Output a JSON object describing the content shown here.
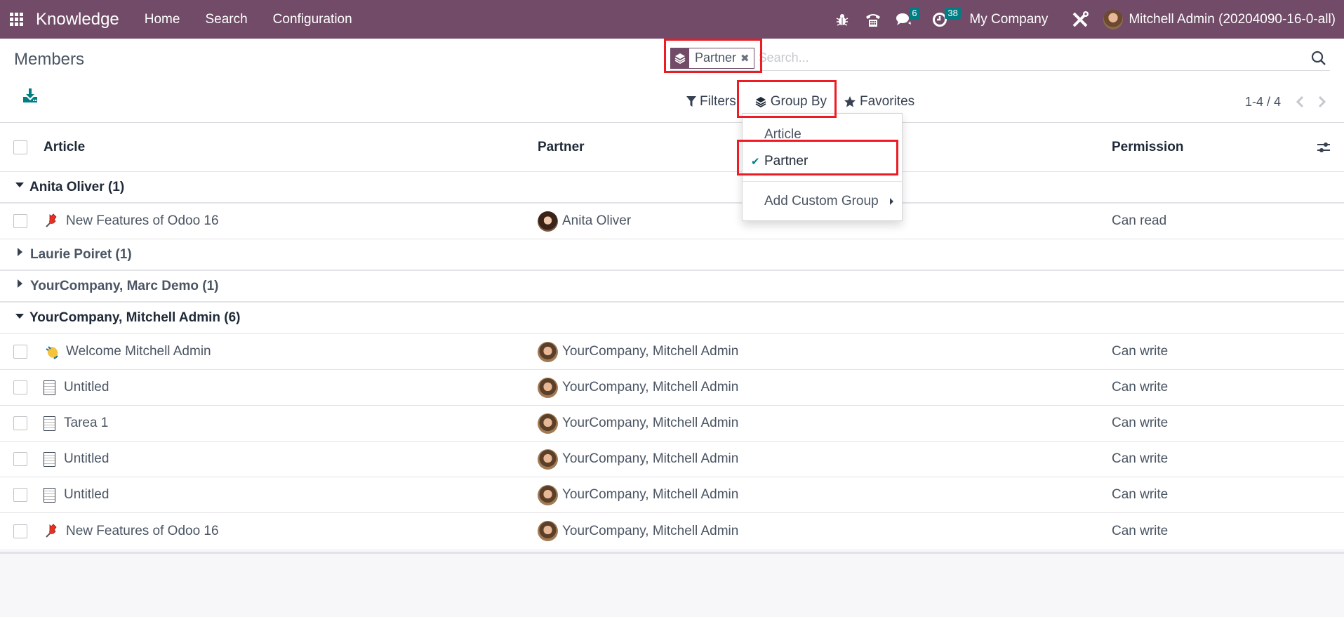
{
  "navbar": {
    "app_name": "Knowledge",
    "menus": [
      "Home",
      "Search",
      "Configuration"
    ],
    "messages_badge": "6",
    "activities_badge": "38",
    "company": "My Company",
    "user": "Mitchell Admin (20204090-16-0-all)",
    "accent_color": "#714b67",
    "badge_color": "#017e84"
  },
  "control": {
    "title": "Members",
    "search": {
      "facet_label": "Partner",
      "placeholder": "Search..."
    },
    "filters_label": "Filters",
    "group_by_label": "Group By",
    "favorites_label": "Favorites",
    "pager": "1-4 / 4"
  },
  "group_by_dropdown": {
    "items": [
      {
        "label": "Article",
        "checked": false
      },
      {
        "label": "Partner",
        "checked": true
      }
    ],
    "custom_group_label": "Add Custom Group"
  },
  "table": {
    "columns": [
      "Article",
      "Partner",
      "Permission"
    ],
    "groups": [
      {
        "label": "Anita Oliver (1)",
        "expanded": true,
        "rows": [
          {
            "icon": "pushpin",
            "article": "New Features of Odoo 16",
            "partner": "Anita Oliver",
            "permission": "Can read"
          }
        ]
      },
      {
        "label": "Laurie Poiret (1)",
        "expanded": false,
        "rows": []
      },
      {
        "label": "YourCompany, Marc Demo (1)",
        "expanded": false,
        "rows": []
      },
      {
        "label": "YourCompany, Mitchell Admin (6)",
        "expanded": true,
        "rows": [
          {
            "icon": "waving-hand",
            "article": "Welcome Mitchell Admin",
            "partner": "YourCompany, Mitchell Admin",
            "permission": "Can write"
          },
          {
            "icon": "document",
            "article": "Untitled",
            "partner": "YourCompany, Mitchell Admin",
            "permission": "Can write"
          },
          {
            "icon": "document",
            "article": "Tarea 1",
            "partner": "YourCompany, Mitchell Admin",
            "permission": "Can write"
          },
          {
            "icon": "document",
            "article": "Untitled",
            "partner": "YourCompany, Mitchell Admin",
            "permission": "Can write"
          },
          {
            "icon": "document",
            "article": "Untitled",
            "partner": "YourCompany, Mitchell Admin",
            "permission": "Can write"
          },
          {
            "icon": "pushpin",
            "article": "New Features of Odoo 16",
            "partner": "YourCompany, Mitchell Admin",
            "permission": "Can write"
          }
        ]
      }
    ]
  }
}
